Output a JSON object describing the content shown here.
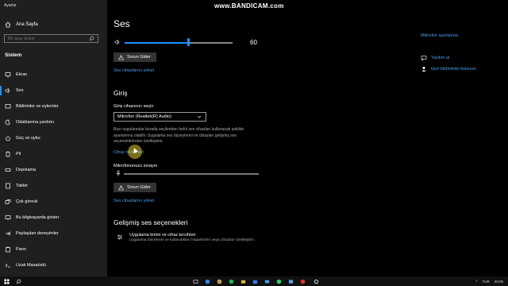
{
  "app_title": "Ayarlar",
  "watermark": "www.BANDICAM.com",
  "sidebar": {
    "home_label": "Ana Sayfa",
    "search_placeholder": "Bir ayar bulun",
    "section_title": "Sistem",
    "items": [
      {
        "label": "Ekran",
        "icon": "monitor-icon"
      },
      {
        "label": "Ses",
        "icon": "speaker-icon",
        "active": true
      },
      {
        "label": "Bildirimler ve eylemler",
        "icon": "notification-icon"
      },
      {
        "label": "Odaklanma yardımı",
        "icon": "moon-icon"
      },
      {
        "label": "Güç ve uyku",
        "icon": "power-icon"
      },
      {
        "label": "Pil",
        "icon": "battery-icon"
      },
      {
        "label": "Depolama",
        "icon": "storage-icon"
      },
      {
        "label": "Tablet",
        "icon": "tablet-icon"
      },
      {
        "label": "Çok görevli",
        "icon": "multitask-icon"
      },
      {
        "label": "Bu bilgisayarda göster",
        "icon": "project-icon"
      },
      {
        "label": "Paylaşılan deneyimler",
        "icon": "share-icon"
      },
      {
        "label": "Pano",
        "icon": "clipboard-icon"
      },
      {
        "label": "Uzak Masaüstü",
        "icon": "remote-desktop-icon"
      }
    ]
  },
  "main": {
    "title": "Ses",
    "volume_value": "60",
    "volume_level": 0.6,
    "output_troubleshoot": "Sorun Gider",
    "output_manage_link": "Ses cihazlarını yönet",
    "input_heading": "Giriş",
    "input_device_label": "Giriş cihazınızı seçin",
    "input_device_value": "Mikrofon (Realtek(R) Audio)",
    "input_desc": "Bazı uygulamalar burada seçilenden farklı ses cihazları kullanacak şekilde ayarlanmış olabilir. Uygulama ses düzeylerini ve cihazları gelişmiş ses seçeneklerinden özelleştirin.",
    "device_props_link": "Cihaz özellikleri",
    "mic_test_label": "Mikrofonunuzu sınayın",
    "input_troubleshoot": "Sorun Gider",
    "input_manage_link": "Ses cihazlarını yönet",
    "advanced_heading": "Gelişmiş ses seçenekleri",
    "advanced_item_title": "Uygulama birimi ve cihaz tercihleri",
    "advanced_item_desc": "Uygulama birimlerini ve kullandıkları hoparlörleri veya cihazları özelleştirin."
  },
  "right_panel": {
    "mic_settings_link": "Mikrofon ayarlarına",
    "help_link": "Yardım al",
    "feedback_link": "Geri bildirimde bulunun"
  },
  "taskbar": {
    "lang": "TUR",
    "time": "20:05"
  },
  "colors": {
    "accent": "#1e90ff",
    "link": "#4d9ff0"
  }
}
